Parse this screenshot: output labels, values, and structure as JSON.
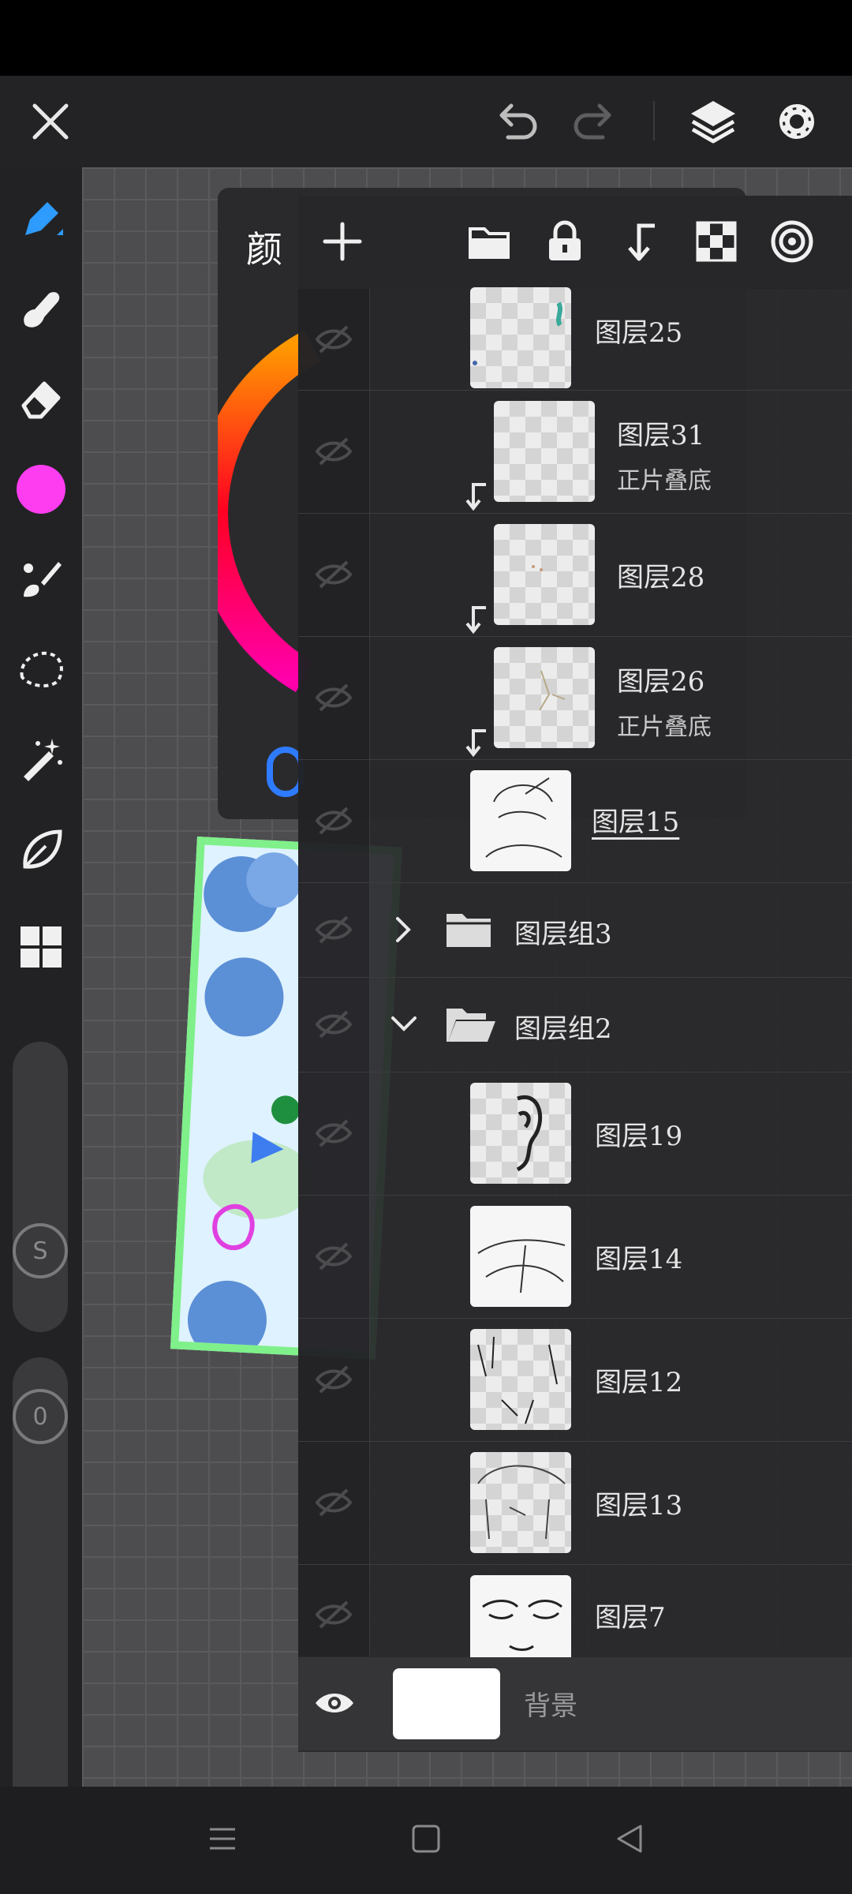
{
  "topbar": {
    "close_icon": "close-icon",
    "undo_icon": "undo-icon",
    "redo_icon": "redo-icon",
    "layers_icon": "layers-icon",
    "settings_icon": "gear-icon"
  },
  "sidebar": {
    "tools": [
      "pen",
      "smudge",
      "eraser",
      "color",
      "brush",
      "lasso",
      "magic-wand",
      "leaf",
      "grid"
    ],
    "current_color": "#ff3df0",
    "size_knob_label": "S",
    "opacity_knob_label": "0"
  },
  "color_panel": {
    "title": "颜"
  },
  "layers": {
    "toolbar": [
      "add",
      "folder",
      "lock",
      "merge-down",
      "checker",
      "target"
    ],
    "items": [
      {
        "name": "图层25",
        "mode": "",
        "clipped": false
      },
      {
        "name": "图层31",
        "mode": "正片叠底",
        "clipped": true
      },
      {
        "name": "图层28",
        "mode": "",
        "clipped": true
      },
      {
        "name": "图层26",
        "mode": "正片叠底",
        "clipped": true
      },
      {
        "name": "图层15",
        "mode": "",
        "clipped": false,
        "selected": true
      },
      {
        "name": "图层组3",
        "type": "group",
        "expanded": false
      },
      {
        "name": "图层组2",
        "type": "group",
        "expanded": true
      },
      {
        "name": "图层19",
        "mode": "",
        "clipped": false
      },
      {
        "name": "图层14",
        "mode": "",
        "clipped": false
      },
      {
        "name": "图层12",
        "mode": "",
        "clipped": false
      },
      {
        "name": "图层13",
        "mode": "",
        "clipped": false
      },
      {
        "name": "图层7",
        "mode": "",
        "clipped": false
      }
    ],
    "background": {
      "name": "背景",
      "visible": true
    }
  },
  "navbar": {
    "items": [
      "menu-icon",
      "home-icon",
      "back-icon"
    ]
  }
}
